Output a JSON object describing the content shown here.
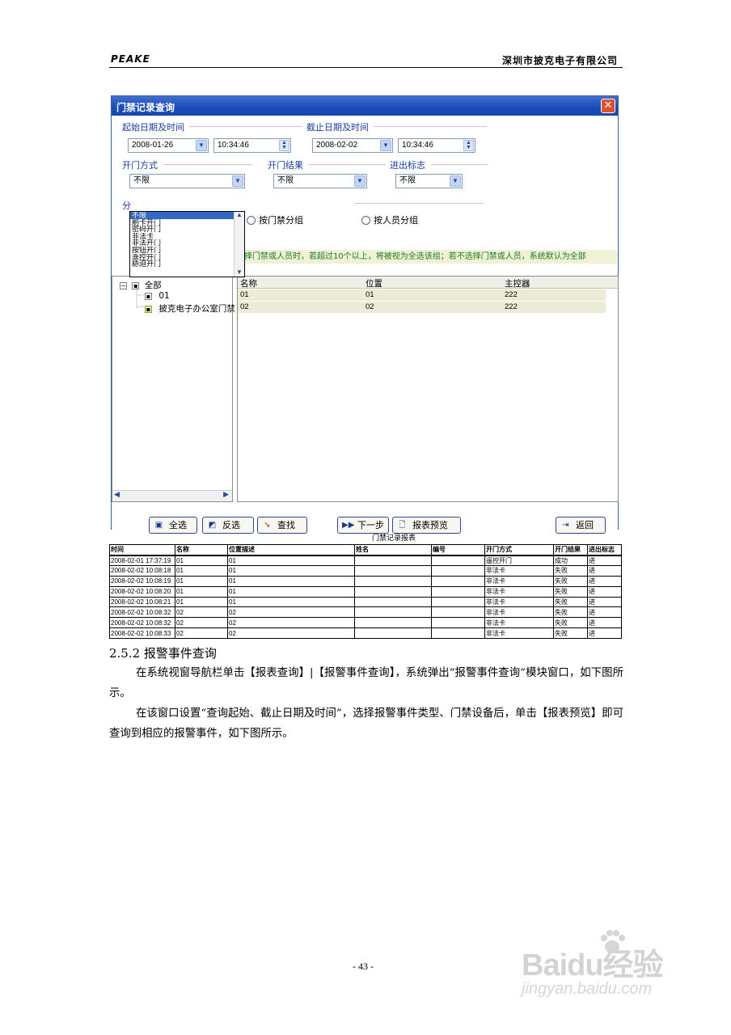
{
  "header": {
    "left": "PEAKE",
    "right": "深圳市披克电子有限公司"
  },
  "window": {
    "title": "门禁记录查询",
    "close_glyph": "✕",
    "start_group": "起始日期及时间",
    "start_date": "2008-01-26",
    "start_time": "10:34:46",
    "end_group": "截止日期及时间",
    "end_date": "2008-02-02",
    "end_time": "10:34:46",
    "open_mode_group": "开门方式",
    "open_mode_value": "不限",
    "open_result_group": "开门结果",
    "open_result_value": "不限",
    "inout_group": "进出标志",
    "inout_value": "不限",
    "open_mode_options": [
      "不限",
      "刷卡开门",
      "密码开门",
      "非法卡",
      "非法开门",
      "按钮开门",
      "遥控开门",
      "胁迫开门"
    ],
    "group_label_partial": "分",
    "radio_door": "按门禁分组",
    "radio_person": "按人员分组",
    "hint": "择门禁或人员时，若超过10个以上，将被视为全选该组；若不选择门禁或人员，系统默认为全部",
    "tree": {
      "root": "全部",
      "child1": "01",
      "child2": "披克电子办公室门禁"
    },
    "list": {
      "columns": [
        "名称",
        "位置",
        "主控器"
      ],
      "rows": [
        [
          "01",
          "01",
          "222"
        ],
        [
          "02",
          "02",
          "222"
        ]
      ]
    },
    "buttons": {
      "select_all": "全选",
      "invert": "反选",
      "find": "查找",
      "next": "下一步",
      "preview": "报表预览",
      "back": "返回"
    }
  },
  "report": {
    "title": "门禁记录报表",
    "columns": [
      "时间",
      "名称",
      "位置描述",
      "姓名",
      "编号",
      "开门方式",
      "开门结果",
      "进出标志"
    ],
    "rows": [
      [
        "2008-02-01 17:37:19",
        "01",
        "01",
        "",
        "",
        "遥控开门",
        "成功",
        "进"
      ],
      [
        "2008-02-02 10:08:18",
        "01",
        "01",
        "",
        "",
        "非法卡",
        "失败",
        "进"
      ],
      [
        "2008-02-02 10:08:19",
        "01",
        "01",
        "",
        "",
        "非法卡",
        "失败",
        "进"
      ],
      [
        "2008-02-02 10:08:20",
        "01",
        "01",
        "",
        "",
        "非法卡",
        "失败",
        "进"
      ],
      [
        "2008-02-02 10:08:21",
        "01",
        "01",
        "",
        "",
        "非法卡",
        "失败",
        "进"
      ],
      [
        "2008-02-02 10:08:32",
        "02",
        "02",
        "",
        "",
        "非法卡",
        "失败",
        "进"
      ],
      [
        "2008-02-02 10:08:32",
        "02",
        "02",
        "",
        "",
        "非法卡",
        "失败",
        "进"
      ],
      [
        "2008-02-02 10:08:33",
        "02",
        "02",
        "",
        "",
        "非法卡",
        "失败",
        "进"
      ]
    ]
  },
  "section": {
    "heading": "2.5.2 报警事件查询",
    "para1": "在系统视窗导航栏单击【报表查询】|【报警事件查询】，系统弹出“报警事件查询”模块窗口，如下图所示。",
    "para2": "在该窗口设置“查询起始、截止日期及时间”，选择报警事件类型、门禁设备后，单击【报表预览】即可查询到相应的报警事件，如下图所示。"
  },
  "page_number": "- 43 -",
  "watermark": {
    "logo": "Baidu经验",
    "url": "jingyan.baidu.com"
  }
}
